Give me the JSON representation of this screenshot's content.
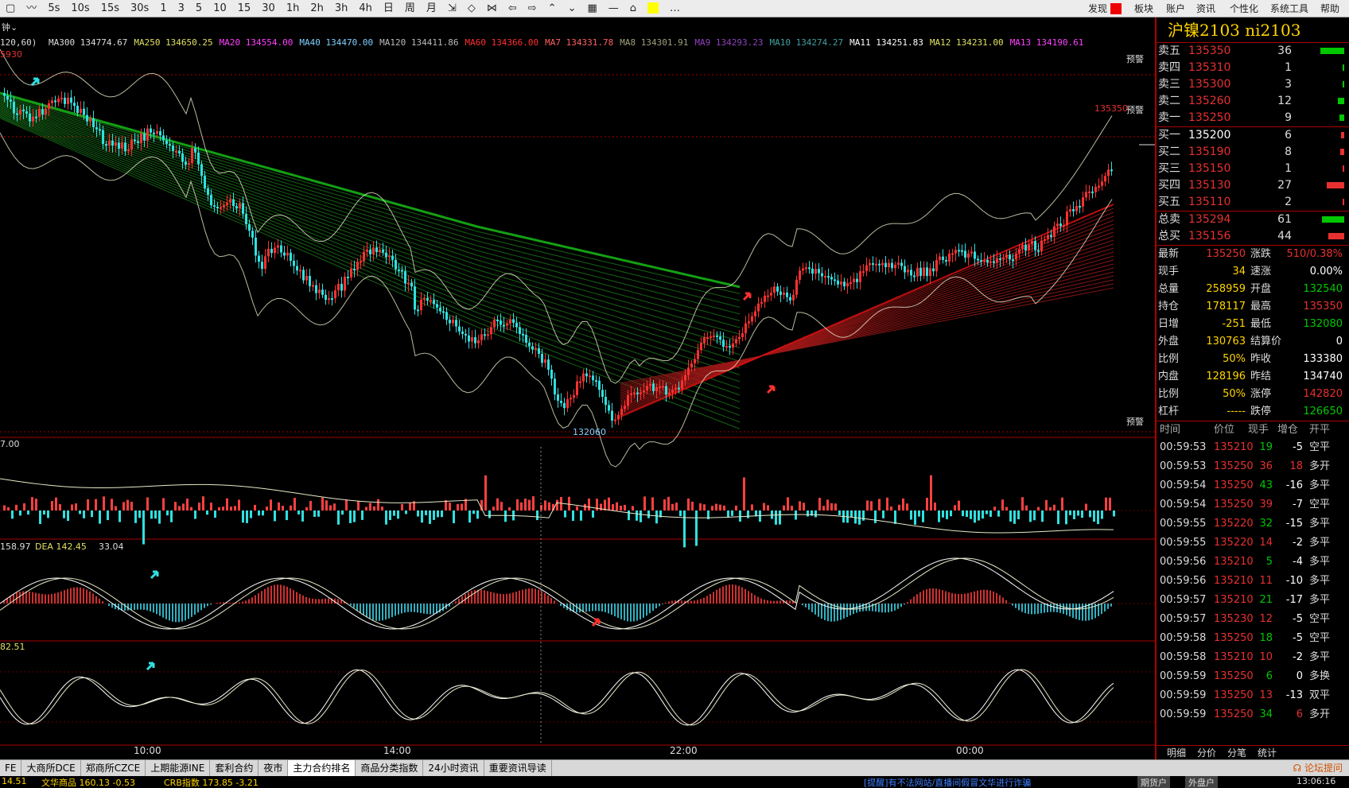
{
  "toolbar": {
    "items": [
      "5s",
      "10s",
      "15s",
      "30s",
      "1",
      "3",
      "5",
      "10",
      "15",
      "30",
      "1h",
      "2h",
      "3h",
      "4h",
      "日",
      "周",
      "月"
    ],
    "right_items": [
      "发现",
      "板块",
      "账户",
      "资讯",
      "个性化",
      "系统工具",
      "帮助"
    ]
  },
  "indicators": {
    "prefix": "120,60)",
    "ma": [
      {
        "label": "MA300 134774.67",
        "color": "#dddddd"
      },
      {
        "label": "MA250 134650.25",
        "color": "#e0e060"
      },
      {
        "label": "MA20 134554.00",
        "color": "#ff40ff"
      },
      {
        "label": "MA40 134470.00",
        "color": "#7fd0ff"
      },
      {
        "label": "MA120 134411.86",
        "color": "#bbbbbb"
      },
      {
        "label": "MA60 134366.00",
        "color": "#ff3030"
      },
      {
        "label": "MA7 134331.78",
        "color": "#ff6060"
      },
      {
        "label": "MA8 134301.91",
        "color": "#a0a080"
      },
      {
        "label": "MA9 134293.23",
        "color": "#9040c0"
      },
      {
        "label": "MA10 134274.27",
        "color": "#40a0a0"
      },
      {
        "label": "MA11 134251.83",
        "color": "#ffffff"
      },
      {
        "label": "MA12 134231.00",
        "color": "#e0e060"
      },
      {
        "label": "MA13 134190.61",
        "color": "#ff40ff"
      }
    ],
    "left_price": "5930",
    "low_label": "132060",
    "high_label": "135350",
    "alarm_label": "预警",
    "vol_label": "7.00",
    "macd_label": "158.97",
    "dea_label": "DEA 142.45",
    "macd_val": "33.04",
    "kdj_label": "82.51"
  },
  "time_axis": [
    "10:00",
    "14:00",
    "22:00",
    "00:00"
  ],
  "bottom_tabs": [
    "FE",
    "大商所DCE",
    "郑商所CZCE",
    "上期能源INE",
    "套利合约",
    "夜市",
    "主力合约排名",
    "商品分类指数",
    "24小时资讯",
    "重要资讯导读"
  ],
  "status": {
    "left": "14.51",
    "mid": "文华商品 160.13 -0.53",
    "mid2": "CRB指数 173.85 -3.21",
    "notice": "[提醒]有不法网站/直播间假冒文华进行诈骗",
    "right1": "期货户",
    "right2": "外盘户",
    "time": "13:06:16"
  },
  "panel": {
    "title": "沪镍2103  ni2103",
    "asks": [
      {
        "name": "卖五",
        "price": "135350",
        "vol": "36",
        "bar": 30
      },
      {
        "name": "卖四",
        "price": "135310",
        "vol": "1",
        "bar": 0
      },
      {
        "name": "卖三",
        "price": "135300",
        "vol": "3",
        "bar": 2
      },
      {
        "name": "卖二",
        "price": "135260",
        "vol": "12",
        "bar": 8
      },
      {
        "name": "卖一",
        "price": "135250",
        "vol": "9",
        "bar": 6
      }
    ],
    "bids": [
      {
        "name": "买一",
        "price": "135200",
        "vol": "6",
        "bar": 4
      },
      {
        "name": "买二",
        "price": "135190",
        "vol": "8",
        "bar": 5
      },
      {
        "name": "买三",
        "price": "135150",
        "vol": "1",
        "bar": 0
      },
      {
        "name": "买四",
        "price": "135130",
        "vol": "27",
        "bar": 22
      },
      {
        "name": "买五",
        "price": "135110",
        "vol": "2",
        "bar": 1
      }
    ],
    "totals": [
      {
        "name": "总卖",
        "price": "135294",
        "vol": "61",
        "bar": 28,
        "color": "green"
      },
      {
        "name": "总买",
        "price": "135156",
        "vol": "44",
        "bar": 20,
        "color": "red"
      }
    ],
    "quote": [
      [
        "最新",
        "135250",
        "#e83030",
        "涨跌",
        "510/0.38%",
        "#e83030"
      ],
      [
        "现手",
        "34",
        "#ffd400",
        "速涨",
        "0.00%",
        "#ffffff"
      ],
      [
        "总量",
        "258959",
        "#ffd400",
        "开盘",
        "132540",
        "#00c800"
      ],
      [
        "持仓",
        "178117",
        "#ffd400",
        "最高",
        "135350",
        "#e83030"
      ],
      [
        "日增",
        "-251",
        "#ffd400",
        "最低",
        "132080",
        "#00c800"
      ],
      [
        "外盘",
        "130763",
        "#ffd400",
        "结算价",
        "0",
        "#ffffff"
      ],
      [
        "比例",
        "50%",
        "#ffd400",
        "昨收",
        "133380",
        "#ffffff"
      ],
      [
        "内盘",
        "128196",
        "#ffd400",
        "昨结",
        "134740",
        "#ffffff"
      ],
      [
        "比例",
        "50%",
        "#ffd400",
        "涨停",
        "142820",
        "#e83030"
      ],
      [
        "杠杆",
        "-----",
        "#ffd400",
        "跌停",
        "126650",
        "#00c800"
      ]
    ],
    "ticks_head": [
      "时间",
      "价位",
      "现手",
      "增仓",
      "开平"
    ],
    "ticks": [
      [
        "00:59:53",
        "135210",
        "19",
        "-5",
        "空平"
      ],
      [
        "00:59:53",
        "135250",
        "36",
        "18",
        "多开"
      ],
      [
        "00:59:54",
        "135250",
        "43",
        "-16",
        "多平"
      ],
      [
        "00:59:54",
        "135250",
        "39",
        "-7",
        "空平"
      ],
      [
        "00:59:55",
        "135220",
        "32",
        "-15",
        "多平"
      ],
      [
        "00:59:55",
        "135220",
        "14",
        "-2",
        "多平"
      ],
      [
        "00:59:56",
        "135210",
        "5",
        "-4",
        "多平"
      ],
      [
        "00:59:56",
        "135210",
        "11",
        "-10",
        "多平"
      ],
      [
        "00:59:57",
        "135210",
        "21",
        "-17",
        "多平"
      ],
      [
        "00:59:57",
        "135230",
        "12",
        "-5",
        "空平"
      ],
      [
        "00:59:58",
        "135250",
        "18",
        "-5",
        "空平"
      ],
      [
        "00:59:58",
        "135210",
        "10",
        "-2",
        "多平"
      ],
      [
        "00:59:59",
        "135250",
        "6",
        "0",
        "多换"
      ],
      [
        "00:59:59",
        "135250",
        "13",
        "-13",
        "双平"
      ],
      [
        "00:59:59",
        "135250",
        "34",
        "6",
        "多开"
      ]
    ],
    "tabs": [
      "明细",
      "分价",
      "分笔",
      "统计"
    ]
  }
}
